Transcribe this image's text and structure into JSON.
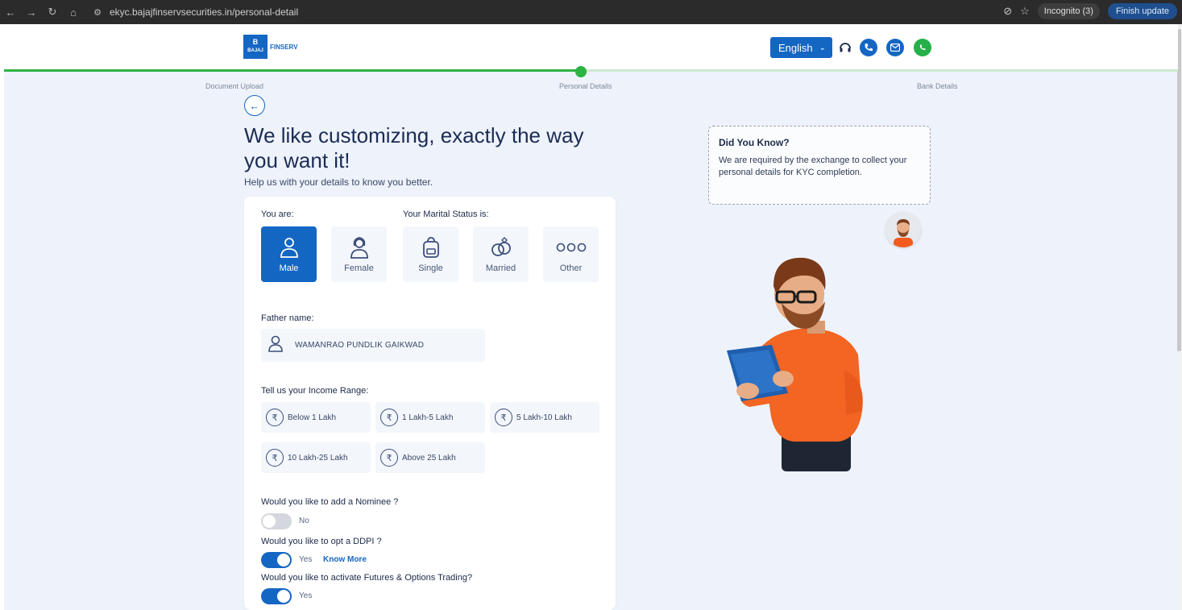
{
  "browser": {
    "url": "ekyc.bajajfinservsecurities.in/personal-detail",
    "incognito_label": "Incognito (3)",
    "finish_update_label": "Finish update"
  },
  "header": {
    "logo_mark": "B",
    "logo_mark_sub": "BAJAJ",
    "logo_text": "FINSERV",
    "language": "English"
  },
  "progress": {
    "fraction_complete": 0.49,
    "steps": [
      "Document Upload",
      "Personal Details",
      "Bank Details"
    ],
    "current_step": 2
  },
  "page": {
    "title": "We like customizing, exactly the way you want it!",
    "subtitle": "Help us with your details to know you better."
  },
  "form": {
    "gender_label": "You are:",
    "marital_label": "Your Marital Status is:",
    "gender_options": [
      "Male",
      "Female"
    ],
    "gender_selected": "Male",
    "marital_options": [
      "Single",
      "Married",
      "Other"
    ],
    "father_label": "Father name:",
    "father_value": "WAMANRAO PUNDLIK GAIKWAD",
    "income_label": "Tell us your Income Range:",
    "income_options": [
      "Below 1 Lakh",
      "1 Lakh-5 Lakh",
      "5 Lakh-10 Lakh",
      "10 Lakh-25 Lakh",
      "Above 25 Lakh"
    ],
    "currency_symbol": "₹",
    "nominee_question": "Would you like to add a Nominee ?",
    "nominee_value": "No",
    "ddpi_question": "Would you like to opt a DDPI ?",
    "ddpi_value": "Yes",
    "know_more": "Know More",
    "fo_question": "Would you like to activate Futures & Options Trading?",
    "fo_value": "Yes"
  },
  "info": {
    "title": "Did You Know?",
    "body": "We are required by the exchange to collect your personal details for KYC completion."
  },
  "colors": {
    "primary": "#1466c3",
    "progress": "#2db344",
    "background": "#eef3fb"
  }
}
